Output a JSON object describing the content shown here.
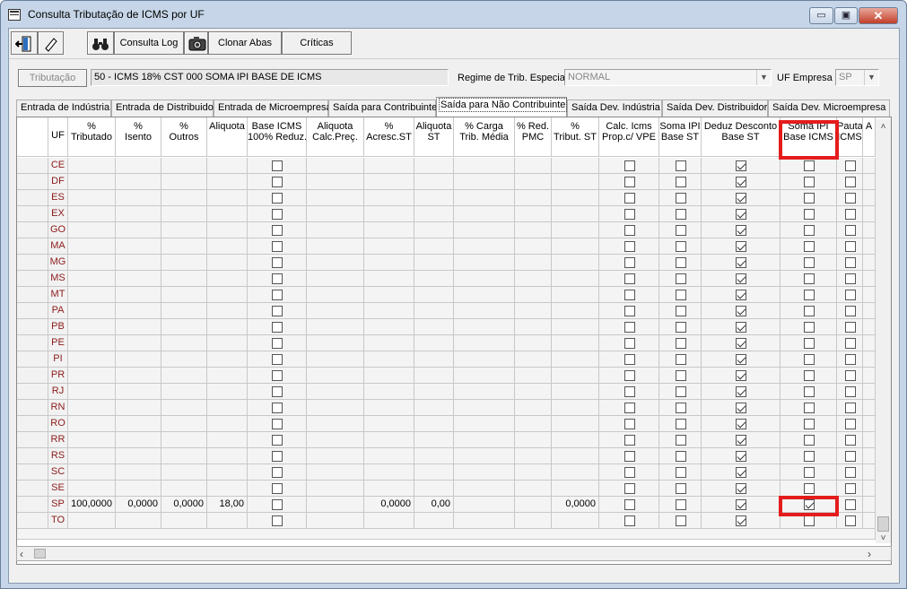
{
  "window": {
    "title": "Consulta Tributação de ICMS por UF",
    "controls": {
      "minimize": "▭",
      "maximize": "▣",
      "close": "✕"
    }
  },
  "toolbar": {
    "btn1_icon": "exit-door-icon",
    "btn2_icon": "eraser-icon",
    "btn3_icon": "binoculars-icon",
    "consulta_log": "Consulta Log",
    "camera_icon": "camera-icon",
    "clonar_abas": "Clonar Abas",
    "criticas": "Críticas"
  },
  "info": {
    "tributacao_button": "Tributação",
    "tributacao_value": "50  -  ICMS 18% CST 000 SOMA IPI BASE DE ICMS",
    "regime_label": "Regime de Trib. Especial",
    "regime_value": "NORMAL",
    "uf_empresa_label": "UF Empresa",
    "uf_empresa_value": "SP"
  },
  "tabs": [
    {
      "label": "Entrada de Indústria",
      "active": false
    },
    {
      "label": "Entrada de Distribuidor",
      "active": false
    },
    {
      "label": "Entrada de Microempresa",
      "active": false
    },
    {
      "label": "Saída para Contribuinte",
      "active": false
    },
    {
      "label": "Saída para Não Contribuinte",
      "active": true
    },
    {
      "label": "Saída Dev. Indústria",
      "active": false
    },
    {
      "label": "Saída Dev. Distribuidor",
      "active": false
    },
    {
      "label": "Saída Dev. Microempresa",
      "active": false
    }
  ],
  "grid": {
    "columns": [
      {
        "label": "UF",
        "key": "uf"
      },
      {
        "label": "%\nTributado",
        "key": "tributado"
      },
      {
        "label": "%\nIsento",
        "key": "isento"
      },
      {
        "label": "%\nOutros",
        "key": "outros"
      },
      {
        "label": "Aliquota",
        "key": "aliquota"
      },
      {
        "label": "Base ICMS\n100% Reduz.",
        "key": "base100"
      },
      {
        "label": "Aliquota\nCalc.Preç.",
        "key": "calcpreco"
      },
      {
        "label": "%\nAcresc.ST",
        "key": "acresc"
      },
      {
        "label": "Aliquota\nST",
        "key": "aliqst"
      },
      {
        "label": "% Carga\nTrib. Média",
        "key": "carga"
      },
      {
        "label": "% Red.\nPMC",
        "key": "redpmc"
      },
      {
        "label": "%\nTribut. ST",
        "key": "tributst"
      },
      {
        "label": "Calc. Icms\nProp.c/ VPE",
        "key": "calcicms"
      },
      {
        "label": "Soma IPI\nBase ST",
        "key": "somaipist"
      },
      {
        "label": "Deduz Desconto\nBase ST",
        "key": "deduz"
      },
      {
        "label": "Soma IPI\nBase ICMS",
        "key": "somaipiicms"
      },
      {
        "label": "Pauta\nICMS",
        "key": "pauta"
      },
      {
        "label": "A",
        "key": "extra"
      }
    ],
    "rows": [
      {
        "uf": "CE",
        "values": {},
        "deduz": true,
        "somaipiicms": false
      },
      {
        "uf": "DF",
        "values": {},
        "deduz": true,
        "somaipiicms": false
      },
      {
        "uf": "ES",
        "values": {},
        "deduz": true,
        "somaipiicms": false
      },
      {
        "uf": "EX",
        "values": {},
        "deduz": true,
        "somaipiicms": false
      },
      {
        "uf": "GO",
        "values": {},
        "deduz": true,
        "somaipiicms": false
      },
      {
        "uf": "MA",
        "values": {},
        "deduz": true,
        "somaipiicms": false
      },
      {
        "uf": "MG",
        "values": {},
        "deduz": true,
        "somaipiicms": false
      },
      {
        "uf": "MS",
        "values": {},
        "deduz": true,
        "somaipiicms": false
      },
      {
        "uf": "MT",
        "values": {},
        "deduz": true,
        "somaipiicms": false
      },
      {
        "uf": "PA",
        "values": {},
        "deduz": true,
        "somaipiicms": false
      },
      {
        "uf": "PB",
        "values": {},
        "deduz": true,
        "somaipiicms": false
      },
      {
        "uf": "PE",
        "values": {},
        "deduz": true,
        "somaipiicms": false
      },
      {
        "uf": "PI",
        "values": {},
        "deduz": true,
        "somaipiicms": false
      },
      {
        "uf": "PR",
        "values": {},
        "deduz": true,
        "somaipiicms": false
      },
      {
        "uf": "RJ",
        "values": {},
        "deduz": true,
        "somaipiicms": false
      },
      {
        "uf": "RN",
        "values": {},
        "deduz": true,
        "somaipiicms": false
      },
      {
        "uf": "RO",
        "values": {},
        "deduz": true,
        "somaipiicms": false
      },
      {
        "uf": "RR",
        "values": {},
        "deduz": true,
        "somaipiicms": false
      },
      {
        "uf": "RS",
        "values": {},
        "deduz": true,
        "somaipiicms": false
      },
      {
        "uf": "SC",
        "values": {},
        "deduz": true,
        "somaipiicms": false
      },
      {
        "uf": "SE",
        "values": {},
        "deduz": true,
        "somaipiicms": false
      },
      {
        "uf": "SP",
        "values": {
          "tributado": "100,0000",
          "isento": "0,0000",
          "outros": "0,0000",
          "aliquota": "18,00",
          "acresc": "0,0000",
          "aliqst": "0,00",
          "tributst": "0,0000"
        },
        "deduz": true,
        "somaipiicms": true
      },
      {
        "uf": "TO",
        "values": {},
        "deduz": true,
        "somaipiicms": false
      }
    ]
  },
  "highlight_color": "#e41c1c"
}
